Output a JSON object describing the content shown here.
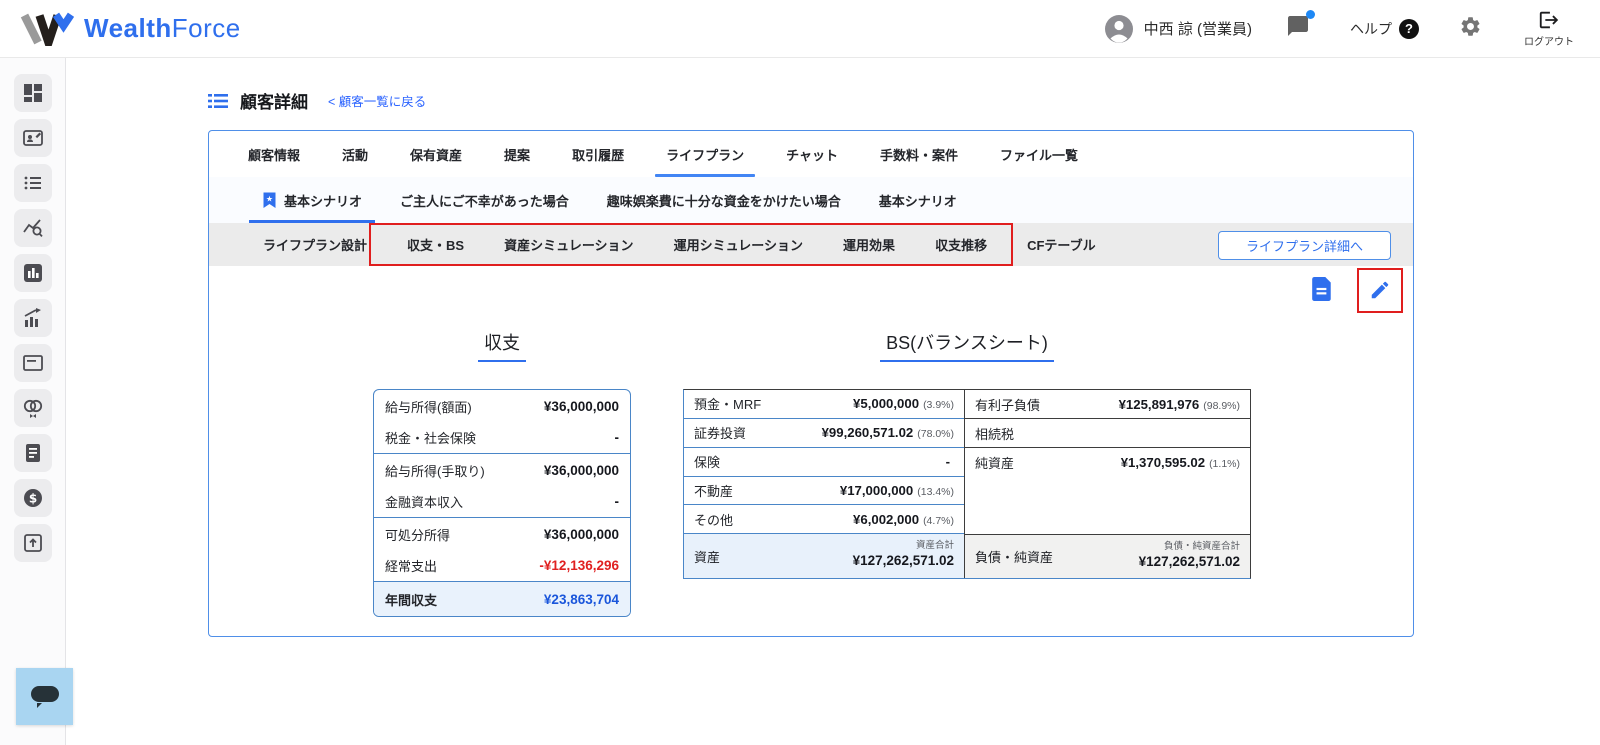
{
  "header": {
    "logo_bold": "Wealth",
    "logo_light": "Force",
    "user_name": "中西 諒 (営業員)",
    "help_label": "ヘルプ",
    "logout_label": "ログアウト"
  },
  "page": {
    "title": "顧客詳細",
    "back_link": "< 顧客一覧に戻る"
  },
  "tabs": {
    "main": [
      {
        "label": "顧客情報"
      },
      {
        "label": "活動"
      },
      {
        "label": "保有資産"
      },
      {
        "label": "提案"
      },
      {
        "label": "取引履歴"
      },
      {
        "label": "ライフプラン",
        "active": true
      },
      {
        "label": "チャット"
      },
      {
        "label": "手数料・案件"
      },
      {
        "label": "ファイル一覧"
      }
    ],
    "scenario": [
      {
        "label": "基本シナリオ",
        "active": true,
        "bookmarked": true
      },
      {
        "label": "ご主人にご不幸があった場合"
      },
      {
        "label": "趣味娯楽費に十分な資金をかけたい場合"
      },
      {
        "label": "基本シナリオ"
      }
    ],
    "sub": [
      {
        "label": "ライフプラン設計"
      },
      {
        "label": "収支・BS"
      },
      {
        "label": "資産シミュレーション"
      },
      {
        "label": "運用シミュレーション"
      },
      {
        "label": "運用効果"
      },
      {
        "label": "収支推移"
      },
      {
        "label": "CFテーブル"
      }
    ],
    "detail_button": "ライフプラン詳細へ"
  },
  "income_table": {
    "title": "収支",
    "rows": [
      {
        "label": "給与所得(額面)",
        "value": "¥36,000,000"
      },
      {
        "label": "税金・社会保険",
        "value": "-"
      },
      {
        "label": "給与所得(手取り)",
        "value": "¥36,000,000"
      },
      {
        "label": "金融資本収入",
        "value": "-"
      },
      {
        "label": "可処分所得",
        "value": "¥36,000,000"
      },
      {
        "label": "経常支出",
        "value": "-¥12,136,296"
      },
      {
        "label": "年間収支",
        "value": "¥23,863,704"
      }
    ]
  },
  "bs_table": {
    "title": "BS(バランスシート)",
    "assets": {
      "rows": [
        {
          "label": "預金・MRF",
          "value": "¥5,000,000",
          "pct": "(3.9%)"
        },
        {
          "label": "証券投資",
          "value": "¥99,260,571.02",
          "pct": "(78.0%)"
        },
        {
          "label": "保険",
          "value": "-",
          "pct": ""
        },
        {
          "label": "不動産",
          "value": "¥17,000,000",
          "pct": "(13.4%)"
        },
        {
          "label": "その他",
          "value": "¥6,002,000",
          "pct": "(4.7%)"
        }
      ],
      "footer": {
        "label": "資産",
        "total_label": "資産合計",
        "value": "¥127,262,571.02"
      }
    },
    "liabilities": {
      "rows": [
        {
          "label": "有利子負債",
          "value": "¥125,891,976",
          "pct": "(98.9%)"
        },
        {
          "label": "相続税",
          "value": "",
          "pct": ""
        },
        {
          "label": "純資産",
          "value": "¥1,370,595.02",
          "pct": "(1.1%)"
        }
      ],
      "footer": {
        "label": "負債・純資産",
        "total_label": "負債・純資産合計",
        "value": "¥127,262,571.02"
      }
    }
  },
  "colors": {
    "brand_blue": "#2f6fed",
    "tab_underline": "#4285f4",
    "annotation_red": "#e01e1e",
    "negative_red": "#e02020",
    "total_blue": "#1a56db",
    "table_border_blue": "#4a86c8",
    "table_border_dark": "#3d3d3d",
    "chat_widget_bg": "#a9d5f1"
  }
}
